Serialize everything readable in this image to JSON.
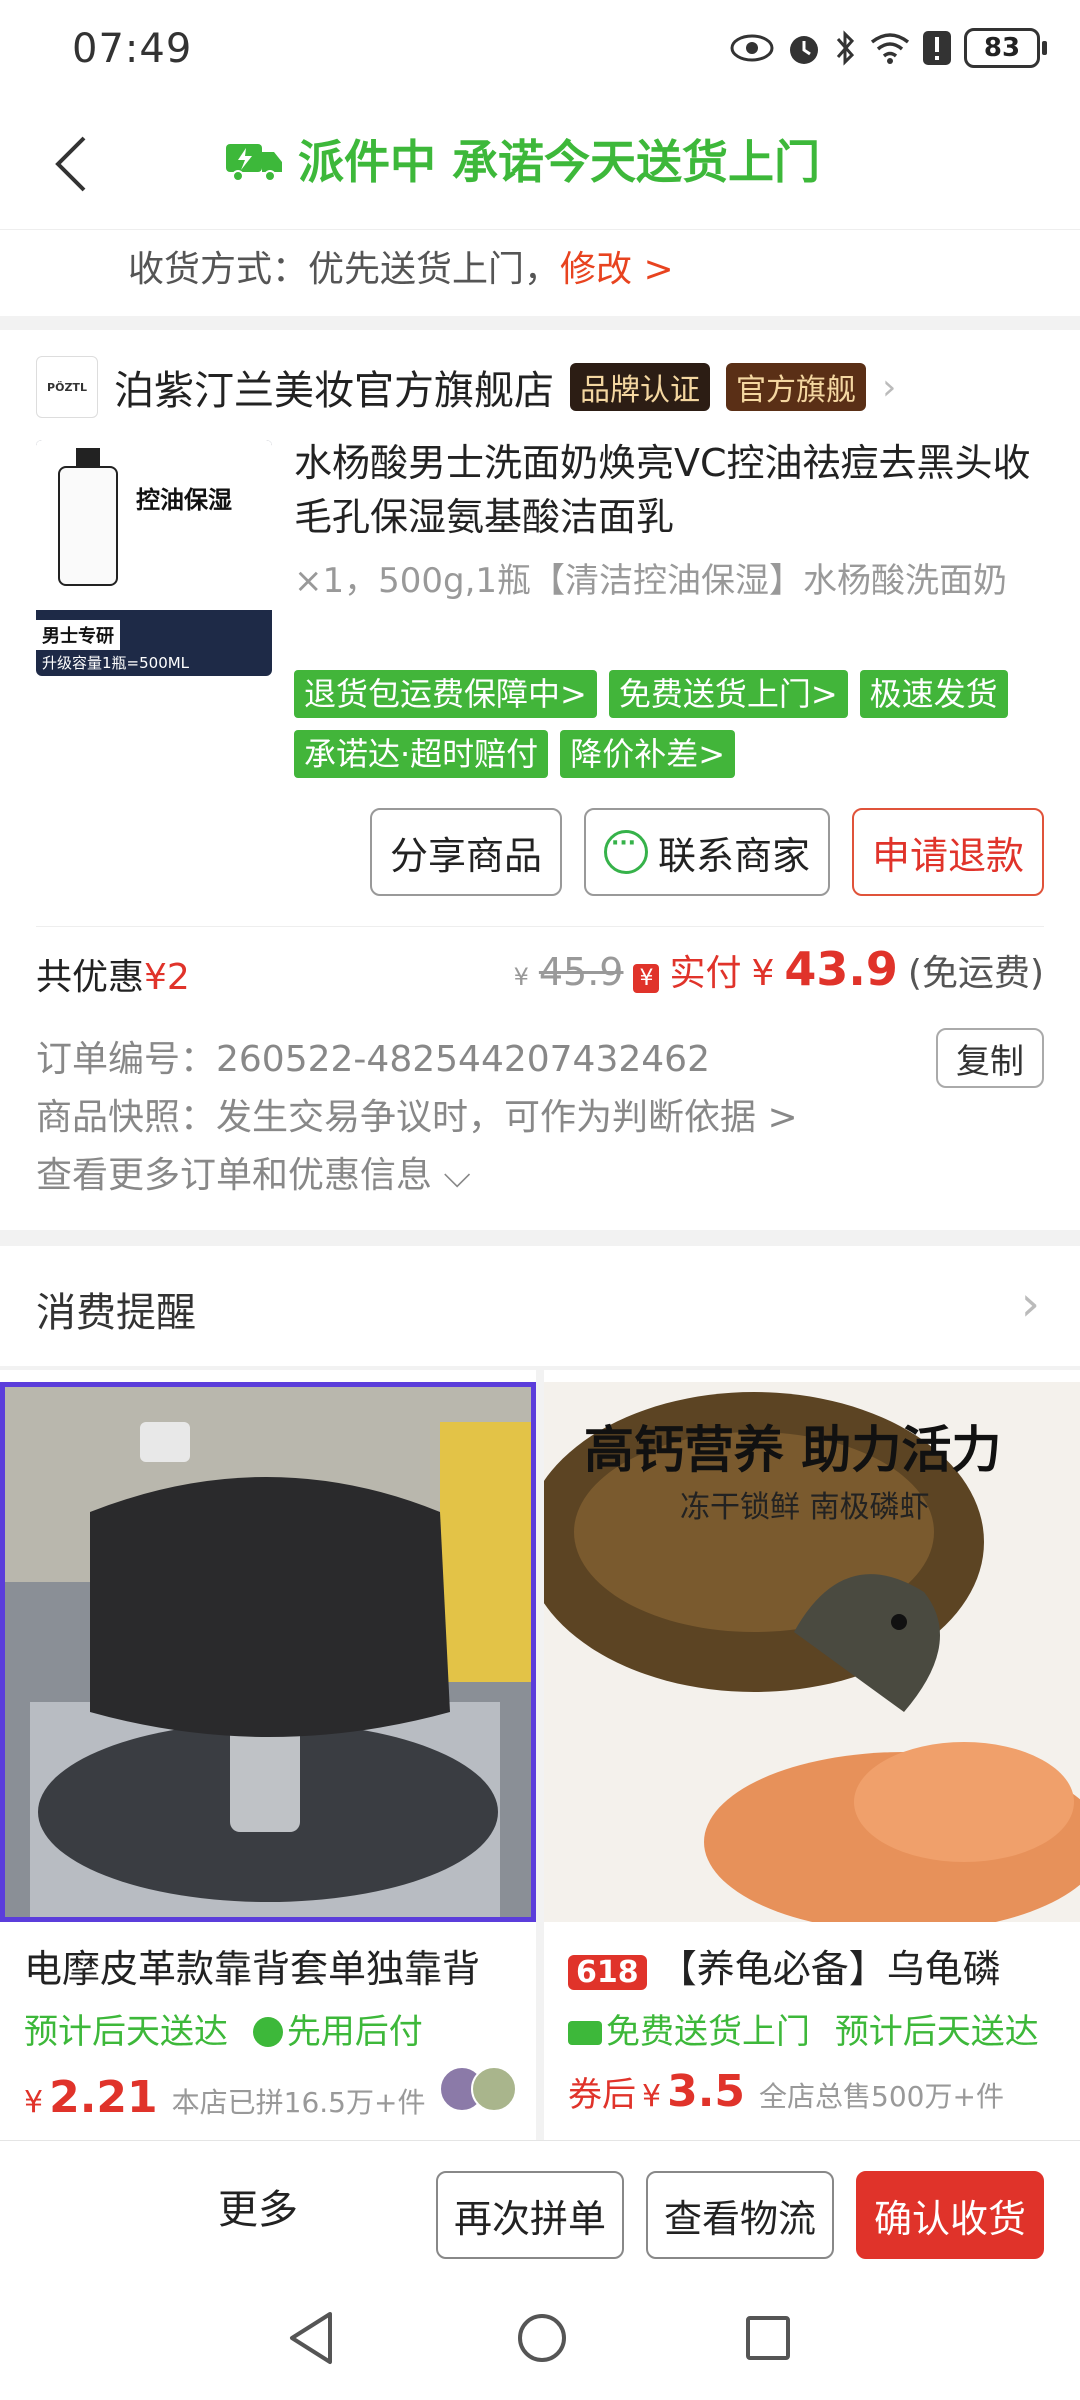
{
  "status_bar": {
    "time": "07:49",
    "battery": "83"
  },
  "header": {
    "title": "派件中 承诺今天送货上门"
  },
  "shipping": {
    "label": "收货方式：优先送货上门，",
    "modify": "修改 >"
  },
  "shop": {
    "logo_text": "PÖZTL",
    "name": "泊紫汀兰美妆官方旗舰店",
    "badge_brand": "品牌认证",
    "badge_official": "官方旗舰"
  },
  "product": {
    "image_label": "控油保湿",
    "image_tag_men": "男士专研",
    "image_tag_capacity": "升级容量1瓶=500ML",
    "title": "水杨酸男士洗面奶焕亮VC控油祛痘去黑头收毛孔保湿氨基酸洁面乳",
    "spec": "×1，500g,1瓶【清洁控油保湿】水杨酸洗面奶",
    "tags": [
      "退货包运费保障中>",
      "免费送货上门>",
      "极速发货",
      "承诺达·超时赔付",
      "降价补差>"
    ]
  },
  "actions": {
    "share": "分享商品",
    "contact": "联系商家",
    "refund": "申请退款"
  },
  "price": {
    "discount_label": "共优惠",
    "discount_value": "¥2",
    "original": "45.9",
    "paid_label": "实付",
    "paid_amount": "43.9",
    "freight": "(免运费)",
    "yen": "¥",
    "paid_icon": "¥"
  },
  "order_info": {
    "order_no": "订单编号：260522-482544207432462",
    "copy": "复制",
    "snapshot": "商品快照：发生交易争议时，可作为判断依据 >",
    "more": "查看更多订单和优惠信息 ⌵"
  },
  "reminder": {
    "label": "消费提醒"
  },
  "recommendations": [
    {
      "name": "电摩皮革款靠背套单独靠背",
      "meta1": "预计后天送达",
      "meta2": "先用后付",
      "price": "2.21",
      "sold": "本店已拼16.5万+件"
    },
    {
      "tag": "618",
      "name": "【养龟必备】乌龟磷",
      "meta1": "免费送货上门",
      "meta2": "预计后天送达",
      "after": "券后",
      "price": "3.5",
      "sold": "全店总售500万+件",
      "banner1": "高钙营养 助力活力",
      "banner2": "冻干锁鲜 南极磷虾"
    }
  ],
  "bottom_bar": {
    "more": "更多",
    "reorder": "再次拼单",
    "logistics": "查看物流",
    "confirm": "确认收货"
  }
}
